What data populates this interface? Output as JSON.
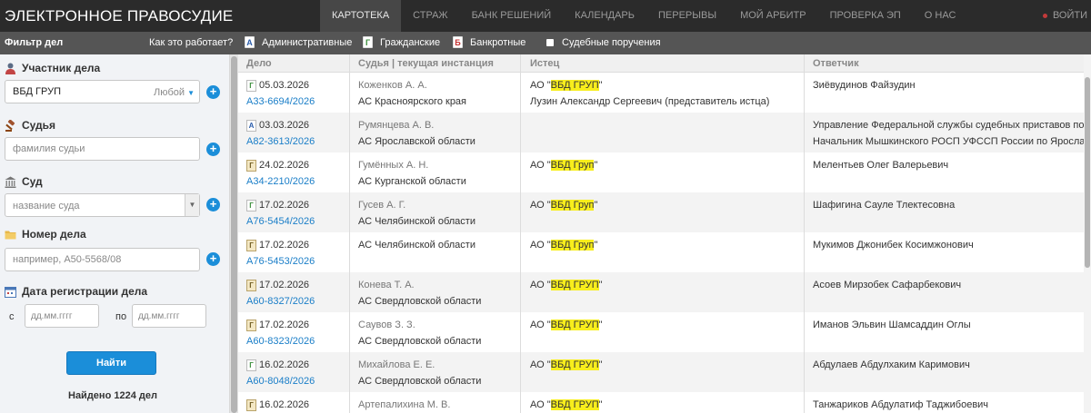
{
  "header": {
    "brand": "ЭЛЕКТРОННОЕ ПРАВОСУДИЕ",
    "nav": [
      {
        "label": "КАРТОТЕКА",
        "active": true
      },
      {
        "label": "СТРАЖ",
        "active": false
      },
      {
        "label": "БАНК РЕШЕНИЙ",
        "active": false
      },
      {
        "label": "КАЛЕНДАРЬ",
        "active": false
      },
      {
        "label": "ПЕРЕРЫВЫ",
        "active": false
      },
      {
        "label": "МОЙ АРБИТР",
        "active": false
      },
      {
        "label": "ПРОВЕРКА ЭП",
        "active": false
      },
      {
        "label": "О НАС",
        "active": false
      }
    ],
    "login": "ВОЙТИ"
  },
  "filterbar": {
    "title": "Фильтр дел",
    "how_it_works": "Как это работает?",
    "categories": [
      {
        "label": "Административные",
        "icon": "А"
      },
      {
        "label": "Гражданские",
        "icon": "Г"
      },
      {
        "label": "Банкротные",
        "icon": "Б"
      },
      {
        "label": "Судебные поручения"
      }
    ]
  },
  "sidebar": {
    "participant": {
      "label": "Участник дела",
      "value": "ВБД ГРУП",
      "mode": "Любой"
    },
    "judge": {
      "label": "Судья",
      "placeholder": "фамилия судьи"
    },
    "court": {
      "label": "Суд",
      "placeholder": "название суда"
    },
    "case_number": {
      "label": "Номер дела",
      "placeholder": "например, А50-5568/08"
    },
    "registration_date": {
      "label": "Дата регистрации дела",
      "from_label": "с",
      "to_label": "по",
      "from_placeholder": "дд.мм.гггг",
      "to_placeholder": "дд.мм.гггг"
    },
    "find_button": "Найти",
    "found_text": "Найдено 1224 дел"
  },
  "table": {
    "headers": {
      "case": "Дело",
      "judge": "Судья | текущая инстанция",
      "plaintiff": "Истец",
      "defendant": "Ответчик"
    },
    "rows": [
      {
        "date": "05.03.2026",
        "number": "А33-6694/2026",
        "icon": "Г",
        "icon_type": "g",
        "judge": "Коженков А. А.",
        "court": "АС Красноярского края",
        "plaintiff_prefix": "АО \"",
        "plaintiff_name": "ВБД ГРУП",
        "plaintiff_suffix": "\"",
        "plaintiff2": "Лузин Александр Сергеевич (представитель истца)",
        "defendant": "Зиёвудинов Файзудин",
        "defendant2": ""
      },
      {
        "date": "03.03.2026",
        "number": "А82-3613/2026",
        "icon": "А",
        "icon_type": "a",
        "judge": "Румянцева А. В.",
        "court": "АС Ярославской области",
        "plaintiff_prefix": "",
        "plaintiff_name": "",
        "plaintiff_suffix": "",
        "plaintiff2": "",
        "defendant": "Управление Федеральной службы судебных приставов по",
        "defendant2": "Начальник Мышкинского РОСП УФССП России по Яросла"
      },
      {
        "date": "24.02.2026",
        "number": "А34-2210/2026",
        "icon": "Г",
        "icon_type": "multi",
        "judge": "Гумённых А. Н.",
        "court": "АС Курганской области",
        "plaintiff_prefix": "АО \"",
        "plaintiff_name": "ВБД Груп",
        "plaintiff_suffix": "\"",
        "plaintiff2": "",
        "defendant": "Мелентьев Олег Валерьевич",
        "defendant2": ""
      },
      {
        "date": "17.02.2026",
        "number": "А76-5454/2026",
        "icon": "Г",
        "icon_type": "g",
        "judge": "Гусев А. Г.",
        "court": "АС Челябинской области",
        "plaintiff_prefix": "АО \"",
        "plaintiff_name": "ВБД Груп",
        "plaintiff_suffix": "\"",
        "plaintiff2": "",
        "defendant": "Шафигина Сауле Тлектесовна",
        "defendant2": ""
      },
      {
        "date": "17.02.2026",
        "number": "А76-5453/2026",
        "icon": "Г",
        "icon_type": "multi",
        "judge": "",
        "court": "АС Челябинской области",
        "plaintiff_prefix": "АО \"",
        "plaintiff_name": "ВБД Груп",
        "plaintiff_suffix": "\"",
        "plaintiff2": "",
        "defendant": "Мукимов Джонибек Косимжонович",
        "defendant2": ""
      },
      {
        "date": "17.02.2026",
        "number": "А60-8327/2026",
        "icon": "Г",
        "icon_type": "multi",
        "judge": "Конева Т. А.",
        "court": "АС Свердловской области",
        "plaintiff_prefix": "АО \"",
        "plaintiff_name": "ВБД ГРУП",
        "plaintiff_suffix": "\"",
        "plaintiff2": "",
        "defendant": "Асоев Мирзобек Сафарбекович",
        "defendant2": ""
      },
      {
        "date": "17.02.2026",
        "number": "А60-8323/2026",
        "icon": "Г",
        "icon_type": "multi",
        "judge": "Саувов З. З.",
        "court": "АС Свердловской области",
        "plaintiff_prefix": "АО \"",
        "plaintiff_name": "ВБД ГРУП",
        "plaintiff_suffix": "\"",
        "plaintiff2": "",
        "defendant": "Иманов Эльвин Шамсаддин Оглы",
        "defendant2": ""
      },
      {
        "date": "16.02.2026",
        "number": "А60-8048/2026",
        "icon": "Г",
        "icon_type": "g",
        "judge": "Михайлова Е. Е.",
        "court": "АС Свердловской области",
        "plaintiff_prefix": "АО \"",
        "plaintiff_name": "ВБД ГРУП",
        "plaintiff_suffix": "\"",
        "plaintiff2": "",
        "defendant": "Абдулаев Абдулхаким Каримович",
        "defendant2": ""
      },
      {
        "date": "16.02.2026",
        "number": "",
        "icon": "Г",
        "icon_type": "multi",
        "judge": "Артепалихина М. В.",
        "court": "",
        "plaintiff_prefix": "АО \"",
        "plaintiff_name": "ВБД ГРУП",
        "plaintiff_suffix": "\"",
        "plaintiff2": "",
        "defendant": "Танжариков Абдулатиф Таджибоевич",
        "defendant2": ""
      }
    ]
  }
}
